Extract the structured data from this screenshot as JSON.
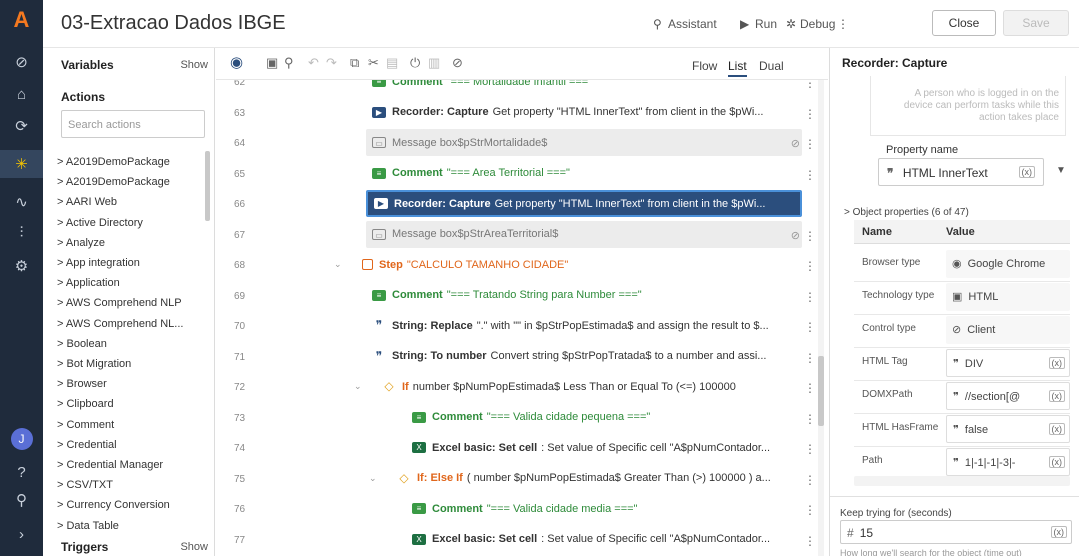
{
  "header": {
    "title": "03-Extracao Dados IBGE",
    "assistant": "Assistant",
    "run": "Run",
    "debug": "Debug",
    "close": "Close",
    "save": "Save"
  },
  "left": {
    "variables": "Variables",
    "variables_show": "Show",
    "actions": "Actions",
    "search_placeholder": "Search actions",
    "items": [
      "A2019DemoPackage",
      "A2019DemoPackage",
      "AARI Web",
      "Active Directory",
      "Analyze",
      "App integration",
      "Application",
      "AWS Comprehend NLP",
      "AWS Comprehend NL...",
      "Boolean",
      "Bot Migration",
      "Browser",
      "Clipboard",
      "Comment",
      "Credential",
      "Credential Manager",
      "CSV/TXT",
      "Currency Conversion",
      "Data Table"
    ],
    "triggers": "Triggers",
    "triggers_show": "Show"
  },
  "toolbar": {
    "flow": "Flow",
    "list": "List",
    "dual": "Dual"
  },
  "rows": [
    {
      "n": "62",
      "kind": "comment",
      "label": "Comment",
      "text": "\"=== Mortalidade Infantil ===\""
    },
    {
      "n": "63",
      "kind": "recorder",
      "label": "Recorder: Capture",
      "text": "Get property \"HTML InnerText\" from client in the $pWi..."
    },
    {
      "n": "64",
      "kind": "msg",
      "label": "Message box",
      "text": "$pStrMortalidade$"
    },
    {
      "n": "65",
      "kind": "comment",
      "label": "Comment",
      "text": "\"=== Area Territorial ===\""
    },
    {
      "n": "66",
      "kind": "recorder",
      "label": "Recorder: Capture",
      "text": "Get property \"HTML InnerText\" from client in the $pWi..."
    },
    {
      "n": "67",
      "kind": "msg",
      "label": "Message box",
      "text": "$pStrAreaTerritorial$"
    },
    {
      "n": "68",
      "kind": "step",
      "label": "Step",
      "text": "\"CALCULO TAMANHO CIDADE\""
    },
    {
      "n": "69",
      "kind": "comment",
      "label": "Comment",
      "text": "\"=== Tratando String para Number ===\""
    },
    {
      "n": "70",
      "kind": "string",
      "label": "String: Replace",
      "text": "\".\" with \"\" in $pStrPopEstimada$ and assign the result to $..."
    },
    {
      "n": "71",
      "kind": "string",
      "label": "String: To number",
      "text": "Convert string $pStrPopTratada$ to a number and assi..."
    },
    {
      "n": "72",
      "kind": "if",
      "label": "If",
      "text": "number $pNumPopEstimada$ Less Than or Equal To (<=) 100000"
    },
    {
      "n": "73",
      "kind": "comment",
      "label": "Comment",
      "text": "\"=== Valida cidade pequena ===\""
    },
    {
      "n": "74",
      "kind": "excel",
      "label": "Excel basic: Set cell",
      "text": ": Set value of Specific cell \"A$pNumContador..."
    },
    {
      "n": "75",
      "kind": "elseif",
      "label": "If: Else If",
      "text": "( number $pNumPopEstimada$ Greater Than (>) 100000 ) a..."
    },
    {
      "n": "76",
      "kind": "comment",
      "label": "Comment",
      "text": "\"=== Valida cidade media ===\""
    },
    {
      "n": "77",
      "kind": "excel",
      "label": "Excel basic: Set cell",
      "text": ": Set value of Specific cell \"A$pNumContador..."
    }
  ],
  "right": {
    "title": "Recorder: Capture",
    "note": "A person who is logged in on the device can perform tasks while this action takes place",
    "property_name_label": "Property name",
    "property_name_value": "HTML InnerText",
    "object_properties": "Object properties (6 of 47)",
    "col_name": "Name",
    "col_value": "Value",
    "props": [
      {
        "name": "Browser type",
        "value": "Google Chrome"
      },
      {
        "name": "Technology type",
        "value": "HTML"
      },
      {
        "name": "Control type",
        "value": "Client"
      },
      {
        "name": "HTML Tag",
        "value": "DIV"
      },
      {
        "name": "DOMXPath",
        "value": "//section[@"
      },
      {
        "name": "HTML HasFrame",
        "value": "false"
      },
      {
        "name": "Path",
        "value": "1|-1|-1|-3|-"
      }
    ],
    "keep_trying_label": "Keep trying for (seconds)",
    "keep_trying_value": "15",
    "hint": "How long we'll search for the object (time out)"
  },
  "colors": {
    "rail": "#1f2b3c",
    "selected_row": "#2b4e7d",
    "accent": "#f47920",
    "green": "#2e8b3a",
    "blue": "#2b5ec8"
  }
}
